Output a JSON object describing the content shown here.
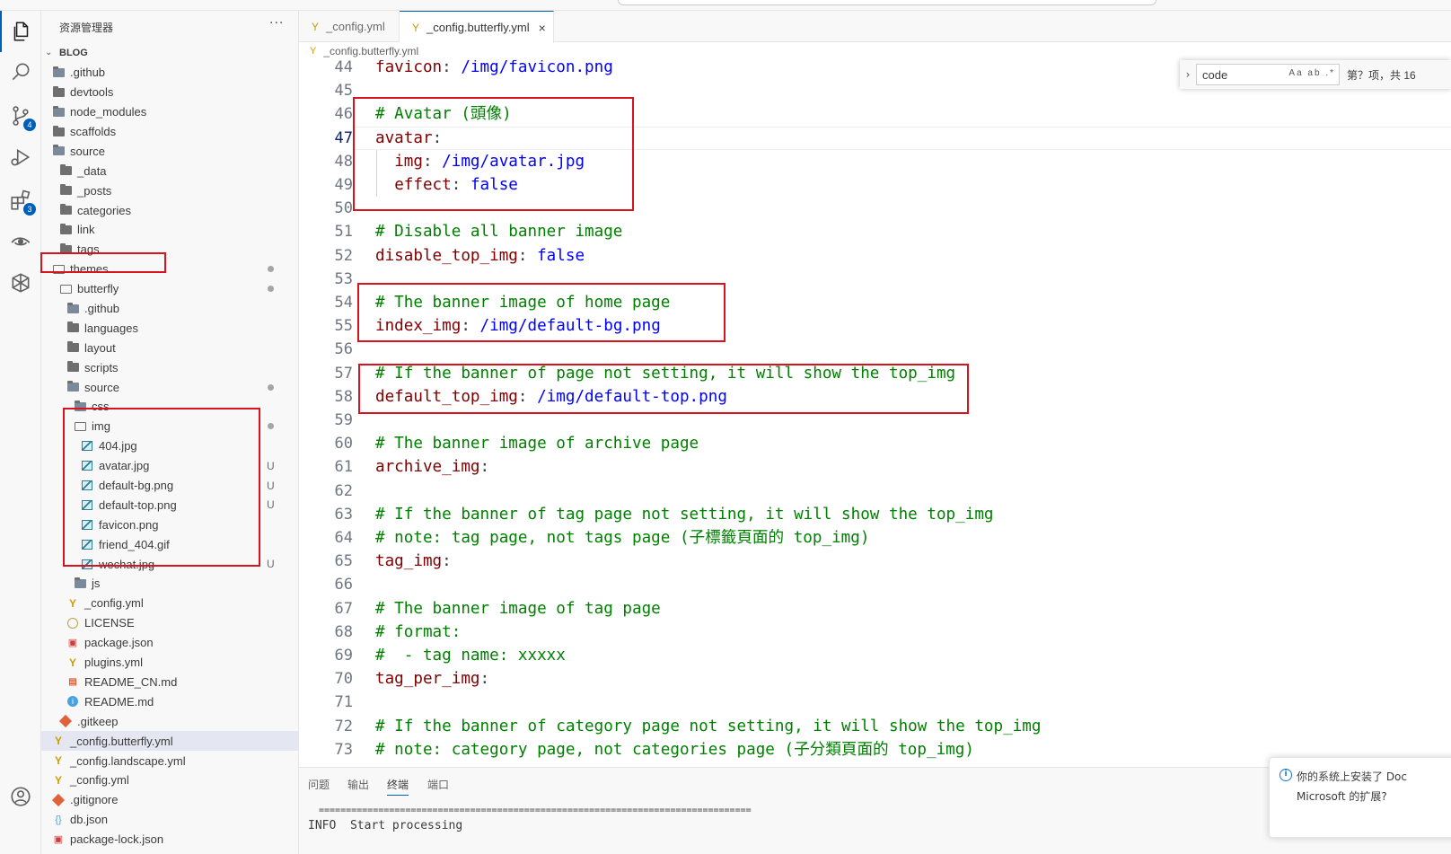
{
  "sidebar": {
    "title": "资源管理器",
    "more": "···",
    "root": "BLOG",
    "items": [
      {
        "label": ".github",
        "icon": "folder-special-icon",
        "indent": 0,
        "git": ""
      },
      {
        "label": "devtools",
        "icon": "folder-icon",
        "indent": 0,
        "git": ""
      },
      {
        "label": "node_modules",
        "icon": "folder-special-icon",
        "indent": 0,
        "git": ""
      },
      {
        "label": "scaffolds",
        "icon": "folder-icon",
        "indent": 0,
        "git": ""
      },
      {
        "label": "source",
        "icon": "folder-special-icon",
        "indent": 0,
        "git": ""
      },
      {
        "label": "_data",
        "icon": "folder-icon",
        "indent": 1,
        "git": ""
      },
      {
        "label": "_posts",
        "icon": "folder-icon",
        "indent": 1,
        "git": ""
      },
      {
        "label": "categories",
        "icon": "folder-icon",
        "indent": 1,
        "git": ""
      },
      {
        "label": "link",
        "icon": "folder-icon",
        "indent": 1,
        "git": ""
      },
      {
        "label": "tags",
        "icon": "folder-icon",
        "indent": 1,
        "git": ""
      },
      {
        "label": "themes",
        "icon": "folder-open-icon",
        "indent": 0,
        "git": "dot"
      },
      {
        "label": "butterfly",
        "icon": "folder-open-icon",
        "indent": 1,
        "git": "dot"
      },
      {
        "label": ".github",
        "icon": "folder-special-icon",
        "indent": 2,
        "git": ""
      },
      {
        "label": "languages",
        "icon": "folder-icon",
        "indent": 2,
        "git": ""
      },
      {
        "label": "layout",
        "icon": "folder-icon",
        "indent": 2,
        "git": ""
      },
      {
        "label": "scripts",
        "icon": "folder-icon",
        "indent": 2,
        "git": ""
      },
      {
        "label": "source",
        "icon": "folder-special-icon",
        "indent": 2,
        "git": "dot"
      },
      {
        "label": "css",
        "icon": "folder-special-icon",
        "indent": 3,
        "git": ""
      },
      {
        "label": "img",
        "icon": "folder-open-icon",
        "indent": 3,
        "git": "dot"
      },
      {
        "label": "404.jpg",
        "icon": "image-icon",
        "indent": 4,
        "git": ""
      },
      {
        "label": "avatar.jpg",
        "icon": "image-icon",
        "indent": 4,
        "git": "U"
      },
      {
        "label": "default-bg.png",
        "icon": "image-icon",
        "indent": 4,
        "git": "U"
      },
      {
        "label": "default-top.png",
        "icon": "image-icon",
        "indent": 4,
        "git": "U"
      },
      {
        "label": "favicon.png",
        "icon": "image-icon",
        "indent": 4,
        "git": ""
      },
      {
        "label": "friend_404.gif",
        "icon": "image-icon",
        "indent": 4,
        "git": ""
      },
      {
        "label": "wechat.jpg",
        "icon": "image-icon",
        "indent": 4,
        "git": "U"
      },
      {
        "label": "js",
        "icon": "folder-special-icon",
        "indent": 3,
        "git": ""
      },
      {
        "label": "_config.yml",
        "icon": "yaml-icon",
        "indent": 2,
        "git": ""
      },
      {
        "label": "LICENSE",
        "icon": "license-icon",
        "indent": 2,
        "git": ""
      },
      {
        "label": "package.json",
        "icon": "json-icon",
        "indent": 2,
        "git": ""
      },
      {
        "label": "plugins.yml",
        "icon": "yaml-icon",
        "indent": 2,
        "git": ""
      },
      {
        "label": "README_CN.md",
        "icon": "markdown-icon",
        "indent": 2,
        "git": ""
      },
      {
        "label": "README.md",
        "icon": "info-icon",
        "indent": 2,
        "git": ""
      },
      {
        "label": ".gitkeep",
        "icon": "git-icon",
        "indent": 1,
        "git": ""
      },
      {
        "label": "_config.butterfly.yml",
        "icon": "yaml-icon",
        "indent": 0,
        "git": "",
        "selected": true
      },
      {
        "label": "_config.landscape.yml",
        "icon": "yaml-icon",
        "indent": 0,
        "git": ""
      },
      {
        "label": "_config.yml",
        "icon": "yaml-icon",
        "indent": 0,
        "git": ""
      },
      {
        "label": ".gitignore",
        "icon": "git-icon",
        "indent": 0,
        "git": ""
      },
      {
        "label": "db.json",
        "icon": "json-braces-icon",
        "indent": 0,
        "git": ""
      },
      {
        "label": "package-lock.json",
        "icon": "json-icon",
        "indent": 0,
        "git": ""
      }
    ]
  },
  "activitybar": {
    "items": [
      "explorer-icon",
      "search-icon",
      "source-control-icon",
      "run-debug-icon",
      "extensions-icon",
      "remote-icon",
      "deploy-icon"
    ],
    "badges": {
      "source_control": "4",
      "extensions": "3"
    },
    "account": "account-icon"
  },
  "tabs": [
    {
      "label": "_config.yml",
      "active": false
    },
    {
      "label": "_config.butterfly.yml",
      "active": true,
      "close": "×"
    }
  ],
  "breadcrumb": "_config.butterfly.yml",
  "editor": {
    "current_line": 47,
    "lines": [
      {
        "n": 44,
        "parts": [
          [
            "ky",
            "favicon"
          ],
          [
            "pu",
            ": "
          ],
          [
            "vl",
            "/img/favicon.png"
          ]
        ]
      },
      {
        "n": 45,
        "parts": []
      },
      {
        "n": 46,
        "parts": [
          [
            "cm",
            "# Avatar (頭像)"
          ]
        ]
      },
      {
        "n": 47,
        "parts": [
          [
            "ky",
            "avatar"
          ],
          [
            "pu",
            ":"
          ]
        ]
      },
      {
        "n": 48,
        "parts": [
          [
            "pu",
            "  "
          ],
          [
            "ky",
            "img"
          ],
          [
            "pu",
            ": "
          ],
          [
            "vl",
            "/img/avatar.jpg"
          ]
        ]
      },
      {
        "n": 49,
        "parts": [
          [
            "pu",
            "  "
          ],
          [
            "ky",
            "effect"
          ],
          [
            "pu",
            ": "
          ],
          [
            "vl",
            "false"
          ]
        ]
      },
      {
        "n": 50,
        "parts": []
      },
      {
        "n": 51,
        "parts": [
          [
            "cm",
            "# Disable all banner image"
          ]
        ]
      },
      {
        "n": 52,
        "parts": [
          [
            "ky",
            "disable_top_img"
          ],
          [
            "pu",
            ": "
          ],
          [
            "vl",
            "false"
          ]
        ]
      },
      {
        "n": 53,
        "parts": []
      },
      {
        "n": 54,
        "parts": [
          [
            "cm",
            "# The banner image of home page"
          ]
        ]
      },
      {
        "n": 55,
        "parts": [
          [
            "ky",
            "index_img"
          ],
          [
            "pu",
            ": "
          ],
          [
            "vl",
            "/img/default-bg.png"
          ]
        ]
      },
      {
        "n": 56,
        "parts": []
      },
      {
        "n": 57,
        "parts": [
          [
            "cm",
            "# If the banner of page not setting, it will show the top_img"
          ]
        ]
      },
      {
        "n": 58,
        "parts": [
          [
            "ky",
            "default_top_img"
          ],
          [
            "pu",
            ": "
          ],
          [
            "vl",
            "/img/default-top.png"
          ]
        ]
      },
      {
        "n": 59,
        "parts": []
      },
      {
        "n": 60,
        "parts": [
          [
            "cm",
            "# The banner image of archive page"
          ]
        ]
      },
      {
        "n": 61,
        "parts": [
          [
            "ky",
            "archive_img"
          ],
          [
            "pu",
            ":"
          ]
        ]
      },
      {
        "n": 62,
        "parts": []
      },
      {
        "n": 63,
        "parts": [
          [
            "cm",
            "# If the banner of tag page not setting, it will show the top_img"
          ]
        ]
      },
      {
        "n": 64,
        "parts": [
          [
            "cm",
            "# note: tag page, not tags page (子標籤頁面的 top_img)"
          ]
        ]
      },
      {
        "n": 65,
        "parts": [
          [
            "ky",
            "tag_img"
          ],
          [
            "pu",
            ":"
          ]
        ]
      },
      {
        "n": 66,
        "parts": []
      },
      {
        "n": 67,
        "parts": [
          [
            "cm",
            "# The banner image of tag page"
          ]
        ]
      },
      {
        "n": 68,
        "parts": [
          [
            "cm",
            "# format:"
          ]
        ]
      },
      {
        "n": 69,
        "parts": [
          [
            "cm",
            "#  - tag name: xxxxx"
          ]
        ]
      },
      {
        "n": 70,
        "parts": [
          [
            "ky",
            "tag_per_img"
          ],
          [
            "pu",
            ":"
          ]
        ]
      },
      {
        "n": 71,
        "parts": []
      },
      {
        "n": 72,
        "parts": [
          [
            "cm",
            "# If the banner of category page not setting, it will show the top_img"
          ]
        ]
      },
      {
        "n": 73,
        "parts": [
          [
            "cm",
            "# note: category page, not categories page (子分類頁面的 top_img)"
          ]
        ]
      }
    ]
  },
  "find": {
    "value": "code",
    "options": "Aa ab .*",
    "count": "第？项，共 16"
  },
  "panel": {
    "tabs": [
      "问题",
      "输出",
      "终端",
      "端口"
    ],
    "active_tab": "终端",
    "rule": "================================================================================",
    "line": "INFO  Start processing"
  },
  "notification": {
    "line1": "你的系统上安装了 Doc",
    "line2": "Microsoft 的扩展?"
  },
  "colors": {
    "accent": "#005fb8",
    "highlight_box": "#d9121f",
    "comment": "#008000",
    "key": "#800000",
    "value": "#0000ff"
  }
}
